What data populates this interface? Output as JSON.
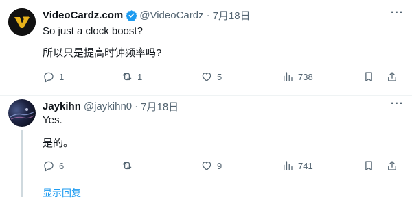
{
  "tweets": [
    {
      "name": "VideoCardz.com",
      "handle": "@VideoCardz",
      "separator": "·",
      "date": "7月18日",
      "lines": [
        "So just a clock boost?",
        "所以只是提高时钟频率吗?"
      ],
      "replies": "1",
      "retweets": "1",
      "likes": "5",
      "views": "738",
      "more_icon": "more-icon",
      "verified_color": "#1d9bf0"
    },
    {
      "name": "Jaykihn",
      "handle": "@jaykihn0",
      "separator": "·",
      "date": "7月18日",
      "lines": [
        "Yes.",
        "是的。"
      ],
      "replies": "6",
      "retweets": "",
      "likes": "9",
      "views": "741",
      "more_icon": "more-icon"
    }
  ],
  "show_replies": "显示回复",
  "colors": {
    "link": "#1d9bf0",
    "muted": "#536471",
    "text": "#0f1419"
  }
}
